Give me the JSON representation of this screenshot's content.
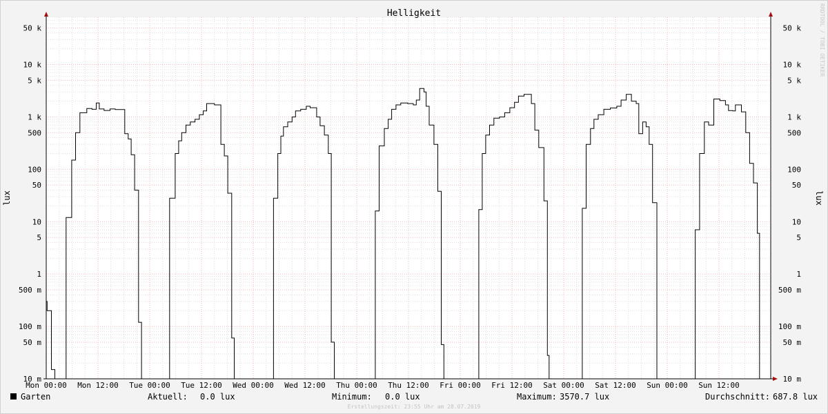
{
  "chart_data": {
    "type": "line",
    "title": "Helligkeit",
    "ylabel": "lux",
    "y_scale": "log",
    "ylim": [
      0.01,
      80000
    ],
    "y_ticks": [
      {
        "value": 50000,
        "label": "50 k"
      },
      {
        "value": 10000,
        "label": "10 k"
      },
      {
        "value": 5000,
        "label": "5 k"
      },
      {
        "value": 1000,
        "label": "1 k"
      },
      {
        "value": 500,
        "label": "500"
      },
      {
        "value": 100,
        "label": "100"
      },
      {
        "value": 50,
        "label": "50"
      },
      {
        "value": 10,
        "label": "10"
      },
      {
        "value": 5,
        "label": "5"
      },
      {
        "value": 1,
        "label": "1"
      },
      {
        "value": 0.5,
        "label": "500 m"
      },
      {
        "value": 0.1,
        "label": "100 m"
      },
      {
        "value": 0.05,
        "label": "50 m"
      },
      {
        "value": 0.01,
        "label": "10 m"
      }
    ],
    "x_unit": "hours since Mon 00:00",
    "xlim": [
      0,
      168
    ],
    "x_ticks": [
      {
        "value": 0,
        "label": "Mon 00:00"
      },
      {
        "value": 12,
        "label": "Mon 12:00"
      },
      {
        "value": 24,
        "label": "Tue 00:00"
      },
      {
        "value": 36,
        "label": "Tue 12:00"
      },
      {
        "value": 48,
        "label": "Wed 00:00"
      },
      {
        "value": 60,
        "label": "Wed 12:00"
      },
      {
        "value": 72,
        "label": "Thu 00:00"
      },
      {
        "value": 84,
        "label": "Thu 12:00"
      },
      {
        "value": 96,
        "label": "Fri 00:00"
      },
      {
        "value": 108,
        "label": "Fri 12:00"
      },
      {
        "value": 120,
        "label": "Sat 00:00"
      },
      {
        "value": 132,
        "label": "Sat 12:00"
      },
      {
        "value": 144,
        "label": "Sun 00:00"
      },
      {
        "value": 156,
        "label": "Sun 12:00"
      }
    ],
    "grid": true,
    "colors": {
      "background": "#f3f3f3",
      "canvas": "#ffffff",
      "line": "#000000",
      "minor_grid": "#dedede",
      "major_grid": "#f0b8b8",
      "axis": "#000000",
      "arrow": "#a01010"
    },
    "series": [
      {
        "name": "Garten",
        "steps": [
          [
            0,
            0.3
          ],
          [
            0.2,
            0.2
          ],
          [
            1.2,
            0.015
          ],
          [
            2,
            0.01
          ],
          [
            4.6,
            12
          ],
          [
            5.9,
            150
          ],
          [
            6.8,
            500
          ],
          [
            7.8,
            1200
          ],
          [
            9.4,
            1450
          ],
          [
            10.6,
            1400
          ],
          [
            11.6,
            1850
          ],
          [
            12.3,
            1420
          ],
          [
            13.4,
            1330
          ],
          [
            14.8,
            1420
          ],
          [
            16,
            1380
          ],
          [
            18.2,
            480
          ],
          [
            19,
            380
          ],
          [
            19.7,
            190
          ],
          [
            20.5,
            40
          ],
          [
            21.4,
            0.12
          ],
          [
            22.1,
            0.01
          ],
          [
            28.6,
            28
          ],
          [
            29.9,
            200
          ],
          [
            30.7,
            350
          ],
          [
            31.4,
            500
          ],
          [
            32.4,
            700
          ],
          [
            33.4,
            800
          ],
          [
            34.5,
            900
          ],
          [
            35.5,
            1100
          ],
          [
            36.4,
            1300
          ],
          [
            37.2,
            1800
          ],
          [
            39,
            1700
          ],
          [
            40.5,
            300
          ],
          [
            41.3,
            180
          ],
          [
            42.1,
            35
          ],
          [
            43,
            0.06
          ],
          [
            43.6,
            0.01
          ],
          [
            52.7,
            28
          ],
          [
            53.7,
            200
          ],
          [
            54.4,
            430
          ],
          [
            55,
            650
          ],
          [
            56,
            800
          ],
          [
            57,
            1000
          ],
          [
            57.8,
            1300
          ],
          [
            59,
            1400
          ],
          [
            60.3,
            1600
          ],
          [
            61.2,
            1500
          ],
          [
            62.7,
            1000
          ],
          [
            63.5,
            680
          ],
          [
            64.5,
            450
          ],
          [
            65.4,
            200
          ],
          [
            66.1,
            0.05
          ],
          [
            66.8,
            0.01
          ],
          [
            76.3,
            16
          ],
          [
            77.2,
            280
          ],
          [
            78.4,
            600
          ],
          [
            79.3,
            900
          ],
          [
            80.1,
            1400
          ],
          [
            81.1,
            1700
          ],
          [
            82.2,
            1850
          ],
          [
            83.8,
            1800
          ],
          [
            85.1,
            1700
          ],
          [
            85.8,
            2100
          ],
          [
            86.6,
            3500
          ],
          [
            87.6,
            3000
          ],
          [
            88.1,
            1600
          ],
          [
            88.8,
            700
          ],
          [
            89.9,
            300
          ],
          [
            90.8,
            38
          ],
          [
            91.6,
            0.045
          ],
          [
            92.2,
            0.01
          ],
          [
            100.3,
            17
          ],
          [
            101.1,
            200
          ],
          [
            101.9,
            450
          ],
          [
            102.8,
            700
          ],
          [
            103.8,
            950
          ],
          [
            105.1,
            1000
          ],
          [
            106.3,
            1200
          ],
          [
            107.5,
            1500
          ],
          [
            108.6,
            1900
          ],
          [
            109.5,
            2500
          ],
          [
            110.8,
            2700
          ],
          [
            112.5,
            1800
          ],
          [
            113.3,
            560
          ],
          [
            114.2,
            260
          ],
          [
            115.4,
            25
          ],
          [
            116.2,
            0.028
          ],
          [
            116.6,
            0.01
          ],
          [
            124.3,
            18
          ],
          [
            125.2,
            300
          ],
          [
            126.2,
            600
          ],
          [
            127,
            900
          ],
          [
            128,
            1100
          ],
          [
            129.3,
            1400
          ],
          [
            130.8,
            1480
          ],
          [
            132.3,
            1600
          ],
          [
            133.3,
            2100
          ],
          [
            134.5,
            2700
          ],
          [
            135.7,
            2000
          ],
          [
            136.8,
            1800
          ],
          [
            137.4,
            480
          ],
          [
            138.3,
            800
          ],
          [
            139.1,
            650
          ],
          [
            139.8,
            300
          ],
          [
            140.6,
            23
          ],
          [
            141.6,
            0.01
          ],
          [
            150.5,
            7
          ],
          [
            151.5,
            200
          ],
          [
            152.6,
            800
          ],
          [
            153.6,
            700
          ],
          [
            154.8,
            2200
          ],
          [
            156.2,
            2050
          ],
          [
            157.5,
            1700
          ],
          [
            158.2,
            1320
          ],
          [
            159.2,
            1300
          ],
          [
            159.8,
            1700
          ],
          [
            161.2,
            1250
          ],
          [
            162.2,
            500
          ],
          [
            163.1,
            130
          ],
          [
            164,
            55
          ],
          [
            164.9,
            6
          ],
          [
            165.4,
            0.01
          ],
          [
            168,
            0.01
          ]
        ]
      }
    ]
  },
  "legend": {
    "series_label": "Garten",
    "series_color": "#000000",
    "current_label": "Aktuell:",
    "current_value": "0.0 lux",
    "minimum_label": "Minimum:",
    "minimum_value": "0.0 lux",
    "maximum_label": "Maximum:",
    "maximum_value": "3570.7 lux",
    "average_label": "Durchschnitt:",
    "average_value": "687.8 lux"
  },
  "footer": "Erstellungszeit: 23:55 Uhr am 28.07.2019",
  "watermark": "RRDTOOL / TOBI OETIKER"
}
